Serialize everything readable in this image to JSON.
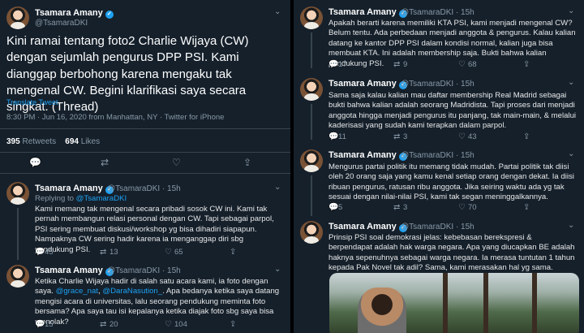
{
  "author": {
    "name": "Tsamara Amany",
    "handle": "@TsamaraDKI"
  },
  "main_tweet": {
    "text": "Kini ramai tentang foto2 Charlie Wijaya (CW) dengan sejumlah pengurus DPP PSI. Kami dianggap berbohong karena mengaku tak mengenal CW. Begini klarifikasi saya secara singkat. (Thread)",
    "translate": "Translate Tweet",
    "timestamp": "8:30 PM · Jun 16, 2020 from Manhattan, NY · Twitter for iPhone",
    "retweets_count": "395",
    "retweets_label": "Retweets",
    "likes_count": "694",
    "likes_label": "Likes"
  },
  "left_replies": [
    {
      "handle_time": "@TsamaraDKI · 15h",
      "replying_prefix": "Replying to ",
      "replying_to": "@TsamaraDKI",
      "text": "Kami memang tak mengenal secara pribadi sosok CW ini. Kami tak pernah membangun relasi personal dengan CW. Tapi sebagai parpol, PSI sering membuat diskusi/workshop yg bisa dihadiri siapapun. Nampaknya CW sering hadir karena ia menganggap diri sbg pendukung PSI.",
      "replies": "45",
      "retweets": "13",
      "likes": "65"
    },
    {
      "handle_time": "@TsamaraDKI · 15h",
      "text_a": "Ketika Charlie Wijaya hadir di salah satu acara kami, ia foto dengan saya. ",
      "mention1": "@grace_nat",
      "text_b": ", ",
      "mention2": "@DaraNasution_",
      "text_c": ". Apa bedanya ketika saya datang mengisi acara di universitas, lalu seorang pendukung meminta foto bersama? Apa saya tau isi kepalanya ketika diajak foto sbg saya bisa menolak?",
      "replies": "15",
      "retweets": "20",
      "likes": "104"
    }
  ],
  "right_tweets": [
    {
      "handle_time": "@TsamaraDKI · 15h",
      "text": "Apakah berarti karena memiliki KTA PSI, kami menjadi mengenal CW? Belum tentu. Ada perbedaan menjadi anggota & pengurus. Kalau kalian datang ke kantor DPP PSI dalam kondisi normal, kalian juga bisa membuat KTA. Ini adalah membership saja. Bukti bahwa kalian pendukung PSI.",
      "replies": "17",
      "retweets": "9",
      "likes": "68"
    },
    {
      "handle_time": "@TsamaraDKI · 15h",
      "text": "Sama saja kalau kalian mau daftar membership Real Madrid sebagai bukti bahwa kalian adalah seorang Madridista. Tapi proses dari menjadi anggota hingga menjadi pengurus itu panjang, tak main-main, & melalui kaderisasi yang sudah kami terapkan dalam parpol.",
      "replies": "11",
      "retweets": "3",
      "likes": "43"
    },
    {
      "handle_time": "@TsamaraDKI · 15h",
      "text": "Mengurus partai politik itu memang tidak mudah. Partai politik tak diisi oleh 20 orang saja yang kamu kenal setiap orang dengan dekat. Ia diisi ribuan pengurus, ratusan ribu anggota. Jika seiring waktu ada yg tak sesuai dengan nilai-nilai PSI, kami tak segan meninggalkannya.",
      "replies": "5",
      "retweets": "3",
      "likes": "70"
    },
    {
      "handle_time": "@TsamaraDKI · 15h",
      "text": "Prinsip PSI soal demokrasi jelas: kebebasan berekspresi & berpendapat adalah hak warga negara. Apa yang diucapkan BE adalah haknya sepenuhnya sebagai warga negara. Ia merasa tuntutan 1 tahun kepada Pak Novel tak adil? Sama, kami merasakan hal yg sama."
    }
  ],
  "icons": {
    "reply": "reply-icon",
    "retweet": "retweet-icon",
    "like": "heart-icon",
    "share": "share-icon",
    "verified": "verified-badge-icon",
    "more": "chevron-down-icon"
  },
  "colors": {
    "background": "#15202b",
    "accent": "#1da1f2",
    "muted": "#8899a6"
  }
}
